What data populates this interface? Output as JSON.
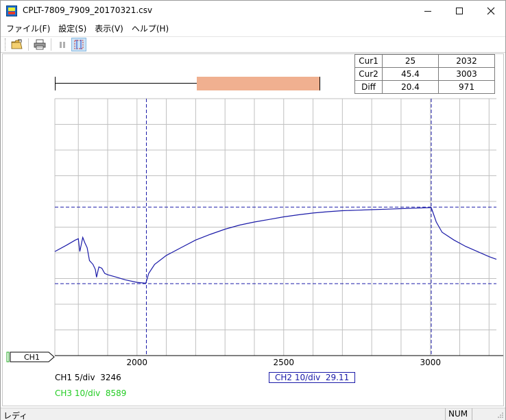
{
  "window": {
    "title": "CPLT-7809_7909_20170321.csv"
  },
  "menu": {
    "items": [
      "ファイル(F)",
      "設定(S)",
      "表示(V)",
      "ヘルプ(H)"
    ]
  },
  "toolbar": {
    "buttons": [
      "open-icon",
      "print-icon",
      "pause-icon",
      "cursor-select-icon"
    ]
  },
  "cursor_table": {
    "rows": [
      {
        "label": "Cur1",
        "v1": "25",
        "v2": "2032"
      },
      {
        "label": "Cur2",
        "v1": "45.4",
        "v2": "3003"
      },
      {
        "label": "Diff",
        "v1": "20.4",
        "v2": "971"
      }
    ]
  },
  "overview": {
    "window_start_fraction": 0.535,
    "window_end_fraction": 1.0
  },
  "chart_data": {
    "type": "line",
    "x_ticks": [
      "2000",
      "2500",
      "3000"
    ],
    "x_tick_values": [
      2000,
      2500,
      3000
    ],
    "xlim": [
      1720,
      3225
    ],
    "ylim": [
      0,
      10
    ],
    "grid": true,
    "series": [
      {
        "name": "CH2",
        "color": "#1a1aa8",
        "x": [
          1720,
          1760,
          1790,
          1800,
          1805,
          1815,
          1822,
          1830,
          1838,
          1850,
          1858,
          1862,
          1870,
          1880,
          1890,
          1900,
          1930,
          1960,
          2000,
          2030,
          2040,
          2060,
          2100,
          2150,
          2200,
          2250,
          2300,
          2350,
          2400,
          2450,
          2500,
          2550,
          2600,
          2650,
          2700,
          2750,
          2800,
          2850,
          2900,
          2950,
          3000,
          3003,
          3020,
          3040,
          3080,
          3120,
          3160,
          3200,
          3225
        ],
        "y": [
          4.05,
          4.3,
          4.5,
          4.55,
          4.05,
          4.6,
          4.4,
          4.2,
          3.7,
          3.55,
          3.35,
          3.05,
          3.45,
          3.4,
          3.2,
          3.15,
          3.05,
          2.95,
          2.85,
          2.82,
          3.2,
          3.55,
          3.9,
          4.2,
          4.5,
          4.72,
          4.92,
          5.08,
          5.2,
          5.3,
          5.4,
          5.48,
          5.55,
          5.6,
          5.64,
          5.66,
          5.68,
          5.7,
          5.72,
          5.74,
          5.76,
          5.76,
          5.2,
          4.8,
          4.5,
          4.25,
          4.05,
          3.85,
          3.75
        ]
      }
    ],
    "cursors": {
      "v1": 2032,
      "v2": 3003,
      "h1": 2.8,
      "h2": 5.78
    }
  },
  "readouts": {
    "ch1": "CH1 5/div  3246",
    "ch2": "CH2 10/div  29.11",
    "ch3": "CH3 10/div  8589",
    "ch1_tag": "CH1"
  },
  "status": {
    "text": "レディ",
    "num": "NUM"
  }
}
